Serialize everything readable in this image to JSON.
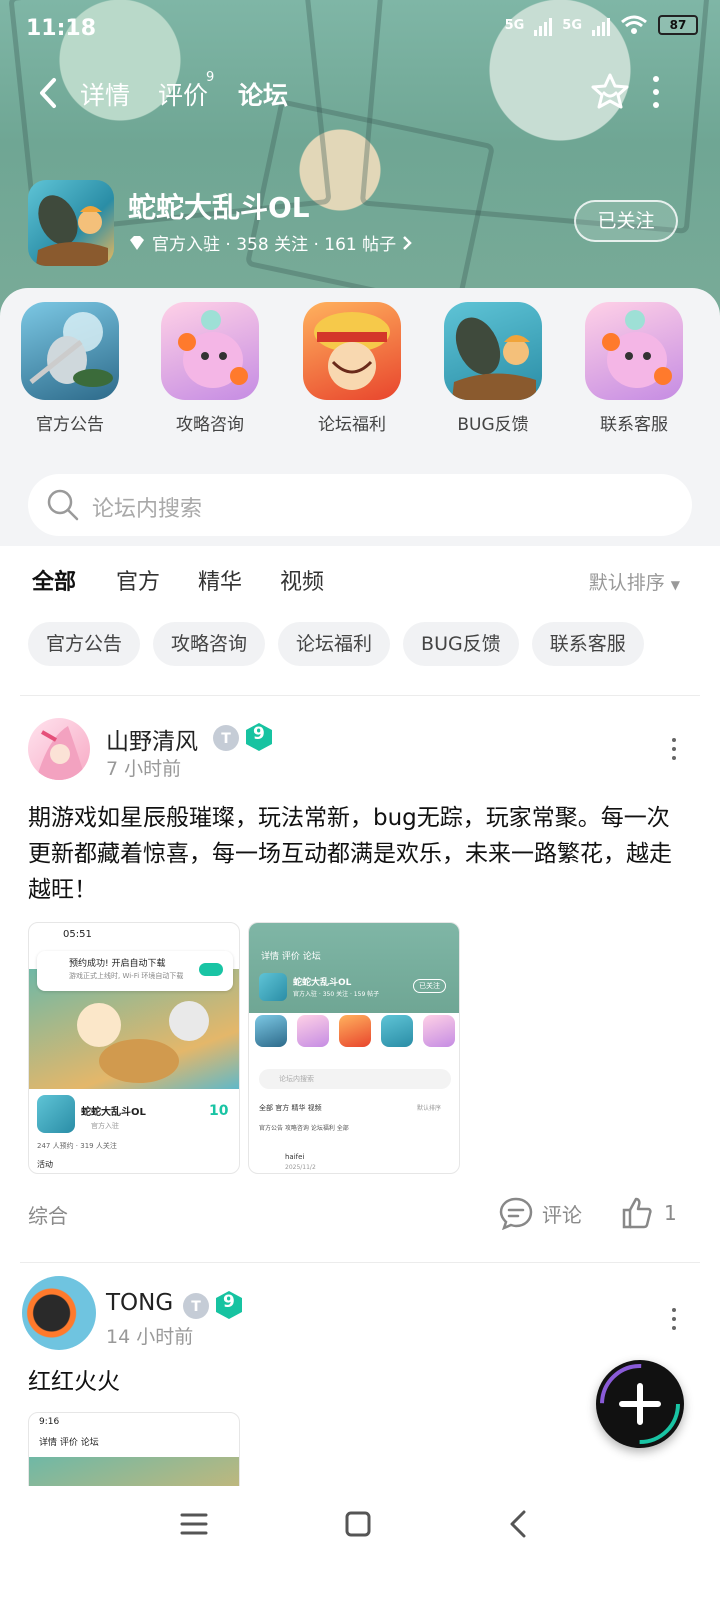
{
  "status": {
    "time": "11:18",
    "net1": "5G",
    "net2": "5G",
    "battery": "87"
  },
  "nav": {
    "tabs": [
      {
        "label": "详情",
        "active": false
      },
      {
        "label": "评价",
        "active": false
      },
      {
        "label": "论坛",
        "active": true
      }
    ],
    "review_badge": "9"
  },
  "game": {
    "name": "蛇蛇大乱斗OL",
    "meta": "官方入驻 · 358 关注 · 161 帖子",
    "follow_label": "已关注"
  },
  "categories": [
    {
      "label": "官方公告"
    },
    {
      "label": "攻略咨询"
    },
    {
      "label": "论坛福利"
    },
    {
      "label": "BUG反馈"
    },
    {
      "label": "联系客服"
    }
  ],
  "search": {
    "placeholder": "论坛内搜索"
  },
  "filters": {
    "tabs": [
      "全部",
      "官方",
      "精华",
      "视频"
    ],
    "sort_label": "默认排序",
    "chips": [
      "官方公告",
      "攻略咨询",
      "论坛福利",
      "BUG反馈",
      "联系客服"
    ]
  },
  "posts": [
    {
      "author": "山野清风",
      "level": "9",
      "time": "7 小时前",
      "text": "期游戏如星辰般璀璨，玩法常新，bug无踪，玩家常聚。每一次更新都藏着惊喜，每一场互动都满是欢乐，未来一路繁花，越走越旺！",
      "tag": "综合",
      "comment_label": "评论",
      "likes": "1",
      "thumb1": {
        "time": "05:51",
        "notice_title": "预约成功! 开启自动下载",
        "notice_sub": "游戏正式上线时, Wi-Fi 环境自动下载",
        "game_name": "蛇蛇大乱斗OL",
        "stats": "247 人预约 · 319 人关注",
        "sub": "官方入驻",
        "badge": "10",
        "activity": "活动"
      },
      "thumb2": {
        "tabs": "详情  评价  论坛",
        "name": "蛇蛇大乱斗OL",
        "meta": "官方入驻 · 350 关注 · 159 帖子",
        "follow": "已关注",
        "search": "论坛内搜索",
        "filter": "全部 官方 精华 视频",
        "sort": "默认排序",
        "chips": "官方公告  攻略咨询  论坛福利  全部",
        "user": "haifei",
        "date": "2025/11/2"
      }
    },
    {
      "author": "TONG",
      "level": "9",
      "time": "14 小时前",
      "text": "红红火火",
      "thumb1": {
        "time": "9:16",
        "tabs": "详情  评价  论坛"
      }
    }
  ]
}
